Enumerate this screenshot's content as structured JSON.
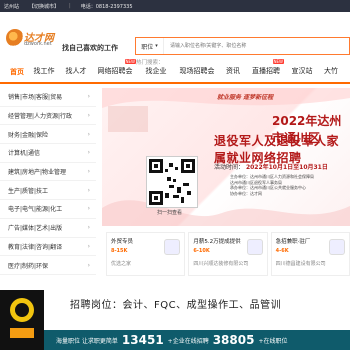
{
  "topbar": {
    "left_text": "达州站",
    "switch_text": "【切换城市】",
    "phone": "电话：0818-2397335"
  },
  "header": {
    "logo_name": "达才网",
    "logo_url": "dzwork.net",
    "slogan": "找自己喜欢的工作",
    "search_category": "职位",
    "search_placeholder": "请输入职位名称/关键字、职位名称",
    "hot_label": "热门搜索：",
    "hot_text": ""
  },
  "nav": [
    {
      "label": "首页",
      "active": true
    },
    {
      "label": "找工作",
      "badge": ""
    },
    {
      "label": "找人才",
      "badge": ""
    },
    {
      "label": "网络招聘会",
      "badge": "NEW"
    },
    {
      "label": "找企业",
      "badge": ""
    },
    {
      "label": "现场招聘会",
      "badge": ""
    },
    {
      "label": "资讯",
      "badge": ""
    },
    {
      "label": "直播招聘",
      "badge": "NEW"
    },
    {
      "label": "宣汉站",
      "badge": ""
    },
    {
      "label": "大竹",
      "badge": ""
    }
  ],
  "sidebar": [
    {
      "label": "销售|市场|客服|贸易"
    },
    {
      "label": "经营管理|人力资源|行政"
    },
    {
      "label": "财务|金融|保险"
    },
    {
      "label": "计算机|通信"
    },
    {
      "label": "建筑|房地产|物业管理"
    },
    {
      "label": "生产|质管|技工"
    },
    {
      "label": "电子|电气|能源|化工"
    },
    {
      "label": "广告|媒体|艺术|出版"
    },
    {
      "label": "教育|法律|咨询|翻译"
    },
    {
      "label": "医疗|制药|环保"
    }
  ],
  "banner": {
    "tagline": "就业服务 逐梦新征程",
    "title_line1": "2022年达州市通川区",
    "title_line2": "退役军人及退役军人家属就业网络招聘",
    "time_label": "活动时间：",
    "time_value": "2022年10月1日至10月31日",
    "organizers": [
      "主办单位：达州市通川区人力资源和社会保障局",
      "达州市通川区退役军人事务局",
      "承办单位：达州市通川区公共就业服务中心",
      "协办单位：达才网"
    ],
    "qr_caption": "扫一扫查看"
  },
  "jobs": [
    {
      "title": "外贸专员",
      "salary": "8-15K",
      "company": "优选之家"
    },
    {
      "title": "月薪5.2万提成提供",
      "salary": "6-10K",
      "company": "四川兴顺达装修有限公司"
    },
    {
      "title": "急招兼职·驻厂",
      "salary": "4-6K",
      "company": "四川德昌建设有限公司"
    }
  ],
  "ad": {
    "recruit_line": "招聘岗位：会计、FQC、成型操作工、品管训",
    "left_label": "海量职位 让求职更简单",
    "count1": "13451",
    "count1_suffix": "+企业在线招聘",
    "count2": "38805",
    "count2_suffix": "+在线职位"
  }
}
